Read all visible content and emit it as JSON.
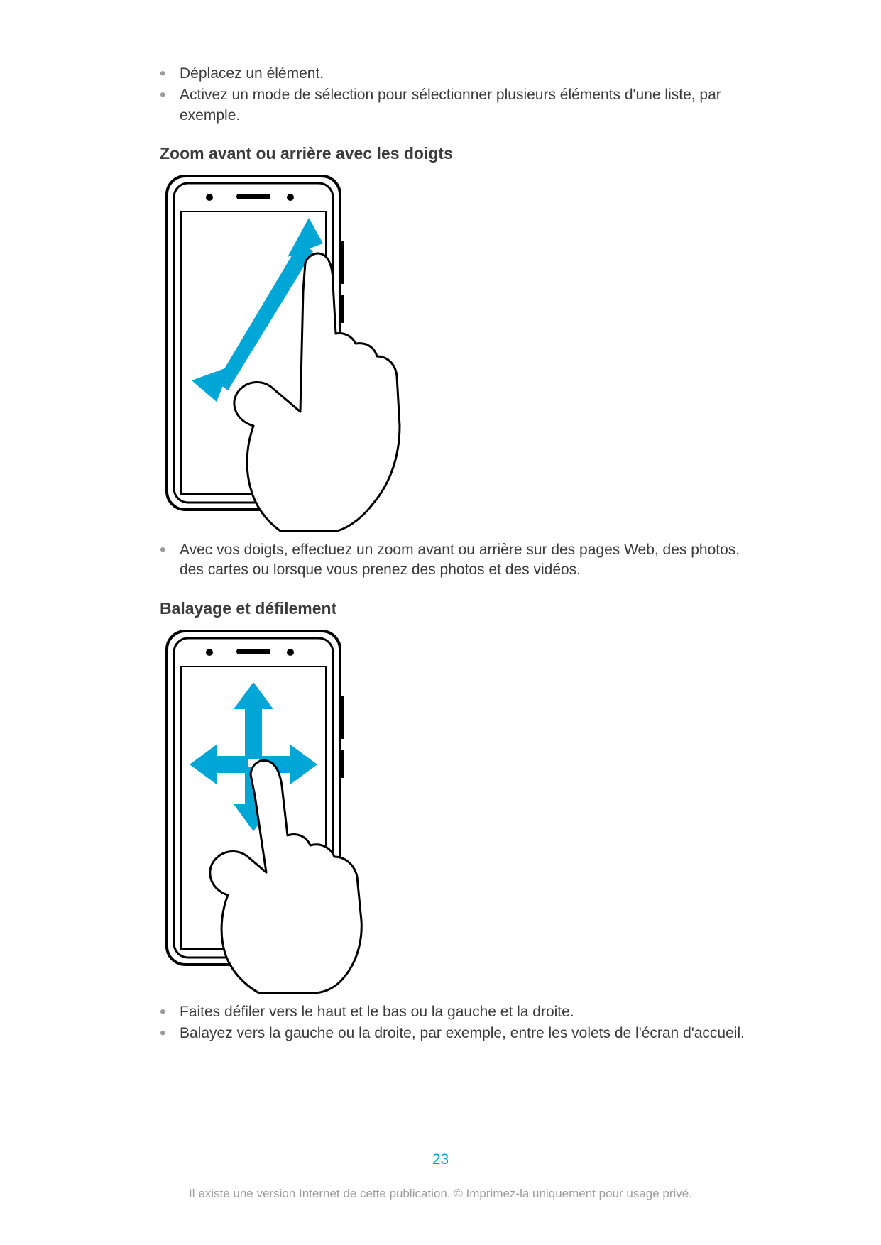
{
  "topBullets": [
    "Déplacez un élément.",
    "Activez un mode de sélection pour sélectionner plusieurs éléments d'une liste, par exemple."
  ],
  "section1": {
    "heading": "Zoom avant ou arrière avec les doigts",
    "bullets": [
      "Avec vos doigts, effectuez un zoom avant ou arrière sur des pages Web, des photos, des cartes ou lorsque vous prenez des photos et des vidéos."
    ]
  },
  "section2": {
    "heading": "Balayage et défilement",
    "bullets": [
      "Faites défiler vers le haut et le bas ou la gauche et la droite.",
      "Balayez vers la gauche ou la droite, par exemple, entre les volets de l'écran d'accueil."
    ]
  },
  "pageNumber": "23",
  "footer": "Il existe une version Internet de cette publication. © Imprimez-la uniquement pour usage privé."
}
